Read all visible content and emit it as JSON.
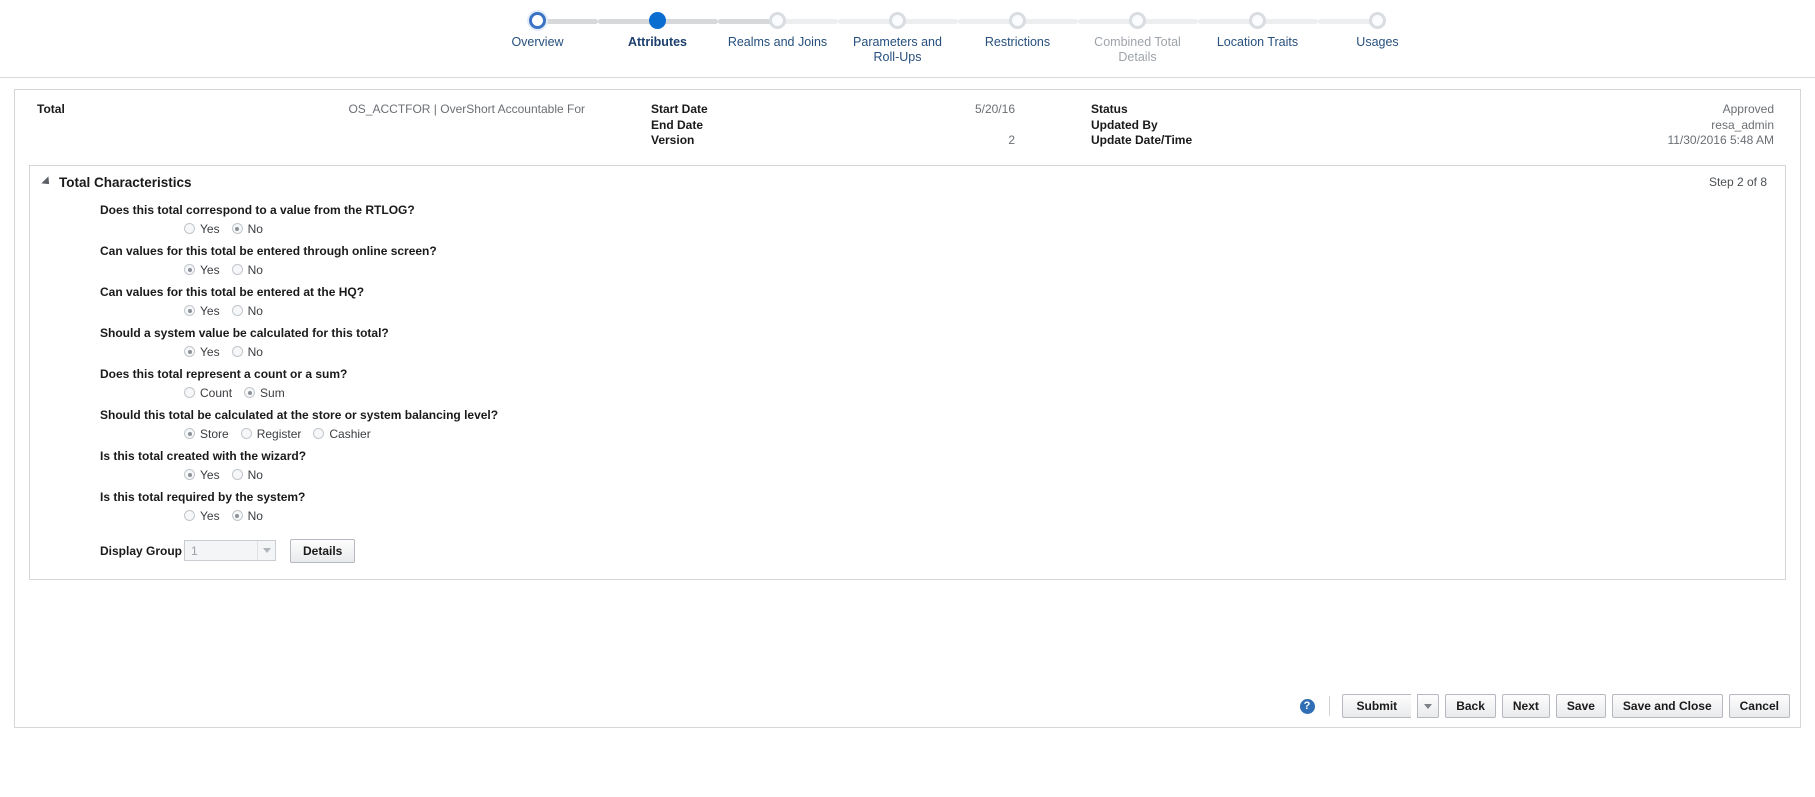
{
  "train": {
    "steps": [
      {
        "label": "Overview",
        "state": "visited"
      },
      {
        "label": "Attributes",
        "state": "current"
      },
      {
        "label": "Realms and Joins",
        "state": "future"
      },
      {
        "label": "Parameters and Roll-Ups",
        "state": "future"
      },
      {
        "label": "Restrictions",
        "state": "future"
      },
      {
        "label": "Combined Total Details",
        "state": "disabled"
      },
      {
        "label": "Location Traits",
        "state": "future"
      },
      {
        "label": "Usages",
        "state": "future"
      }
    ]
  },
  "summary": {
    "col1": [
      {
        "label": "Total",
        "value": "OS_ACCTFOR | OverShort Accountable For"
      }
    ],
    "col2": [
      {
        "label": "Start Date",
        "value": "5/20/16"
      },
      {
        "label": "End Date",
        "value": ""
      },
      {
        "label": "Version",
        "value": "2"
      }
    ],
    "col3": [
      {
        "label": "Status",
        "value": "Approved"
      },
      {
        "label": "Updated By",
        "value": "resa_admin"
      },
      {
        "label": "Update Date/Time",
        "value": "11/30/2016 5:48 AM"
      }
    ]
  },
  "card": {
    "title": "Total Characteristics",
    "step_indicator": "Step 2 of 8",
    "questions": [
      {
        "text": "Does this total correspond to a value from the RTLOG?",
        "options": [
          {
            "label": "Yes",
            "checked": false
          },
          {
            "label": "No",
            "checked": true
          }
        ]
      },
      {
        "text": "Can values for this total be entered through online screen?",
        "options": [
          {
            "label": "Yes",
            "checked": true
          },
          {
            "label": "No",
            "checked": false
          }
        ]
      },
      {
        "text": "Can values for this total be entered at the HQ?",
        "options": [
          {
            "label": "Yes",
            "checked": true
          },
          {
            "label": "No",
            "checked": false
          }
        ]
      },
      {
        "text": "Should a system value be calculated for this total?",
        "options": [
          {
            "label": "Yes",
            "checked": true
          },
          {
            "label": "No",
            "checked": false
          }
        ]
      },
      {
        "text": "Does this total represent a count or a sum?",
        "options": [
          {
            "label": "Count",
            "checked": false
          },
          {
            "label": "Sum",
            "checked": true
          }
        ]
      },
      {
        "text": "Should this total be calculated at the store or system balancing level?",
        "options": [
          {
            "label": "Store",
            "checked": true
          },
          {
            "label": "Register",
            "checked": false
          },
          {
            "label": "Cashier",
            "checked": false
          }
        ]
      },
      {
        "text": "Is this total created with the wizard?",
        "options": [
          {
            "label": "Yes",
            "checked": true
          },
          {
            "label": "No",
            "checked": false
          }
        ]
      },
      {
        "text": "Is this total required by the system?",
        "options": [
          {
            "label": "Yes",
            "checked": false
          },
          {
            "label": "No",
            "checked": true
          }
        ]
      }
    ],
    "display_group": {
      "label": "Display Group",
      "value": "1",
      "details_label": "Details"
    }
  },
  "footer": {
    "help_glyph": "?",
    "submit_label": "Submit",
    "back_label": "Back",
    "next_label": "Next",
    "save_label": "Save",
    "save_close_label": "Save and Close",
    "cancel_label": "Cancel"
  }
}
